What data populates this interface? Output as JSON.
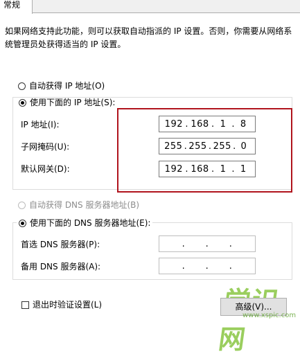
{
  "tab": {
    "label": "常规"
  },
  "description": "如果网络支持此功能，则可以获取自动指派的 IP 设置。否则，你需要从网络系统管理员处获得适当的 IP 设置。",
  "ip_section": {
    "auto_option": "自动获得 IP 地址(O)",
    "manual_option": "使用下面的 IP 地址(S):",
    "selected": "manual",
    "fields": [
      {
        "label": "IP 地址(I):",
        "octets": [
          "192",
          "168",
          "1",
          "8"
        ]
      },
      {
        "label": "子网掩码(U):",
        "octets": [
          "255",
          "255",
          "255",
          "0"
        ]
      },
      {
        "label": "默认网关(D):",
        "octets": [
          "192",
          "168",
          "1",
          "1"
        ]
      }
    ]
  },
  "dns_section": {
    "auto_option": "自动获得 DNS 服务器地址(B)",
    "manual_option": "使用下面的 DNS 服务器地址(E):",
    "selected": "manual",
    "fields": [
      {
        "label": "首选 DNS 服务器(P):",
        "octets": [
          "",
          "",
          "",
          ""
        ]
      },
      {
        "label": "备用 DNS 服务器(A):",
        "octets": [
          "",
          "",
          "",
          ""
        ]
      }
    ]
  },
  "validate_checkbox": {
    "label": "退出时验证设置(L)",
    "checked": false
  },
  "advanced_button": {
    "label": "高级(V)..."
  },
  "watermark": {
    "text": "学识网",
    "url": "www.xspic.com"
  },
  "colors": {
    "highlight": "#b0131c",
    "disabled": "#8d8d8d"
  }
}
